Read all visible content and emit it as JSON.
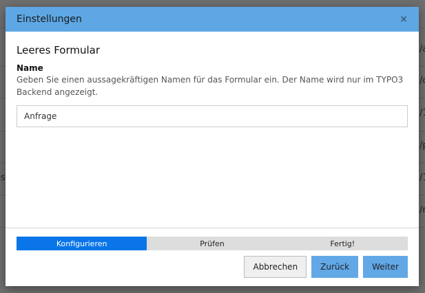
{
  "background_fragments": [
    "/a",
    "/c",
    "/1",
    "/p",
    "es",
    "/1",
    "/r"
  ],
  "modal": {
    "title": "Einstellungen",
    "close_icon": "close-icon",
    "heading": "Leeres Formular",
    "field_label": "Name",
    "field_help": "Geben Sie einen aussagekräftigen Namen für das Formular ein. Der Name wird nur im TYPO3 Backend angezeigt.",
    "field_value": "Anfrage",
    "steps": [
      {
        "label": "Konfigurieren",
        "active": true
      },
      {
        "label": "Prüfen",
        "active": false
      },
      {
        "label": "Fertig!",
        "active": false
      }
    ],
    "buttons": {
      "cancel": "Abbrechen",
      "back": "Zurück",
      "next": "Weiter"
    },
    "colors": {
      "header": "#5ea7e4",
      "active_step": "#0a75e8",
      "primary_button": "#62a8e6"
    }
  }
}
